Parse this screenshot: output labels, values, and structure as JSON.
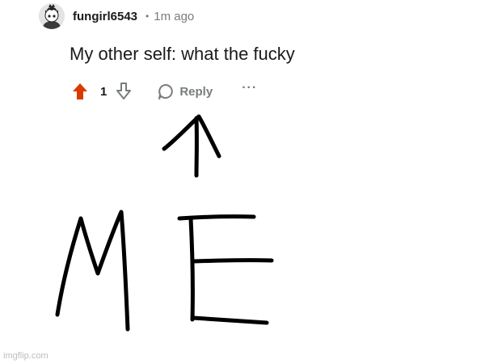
{
  "comment": {
    "username": "fungirl6543",
    "separator": "•",
    "timestamp": "1m ago",
    "body": "My other self: what the fucky",
    "vote_count": "1",
    "reply_label": "Reply",
    "more_label": "···"
  },
  "drawing": {
    "note": "handwritten arrow pointing up and letters",
    "text": "ME"
  },
  "watermark": "imgflip.com",
  "colors": {
    "upvote_active": "#d93a00",
    "muted": "#787c7e",
    "text": "#1a1a1b",
    "ink": "#000000"
  },
  "icons": [
    "avatar",
    "upvote-arrow-icon",
    "downvote-arrow-icon",
    "comment-bubble-icon",
    "more-options-icon"
  ]
}
